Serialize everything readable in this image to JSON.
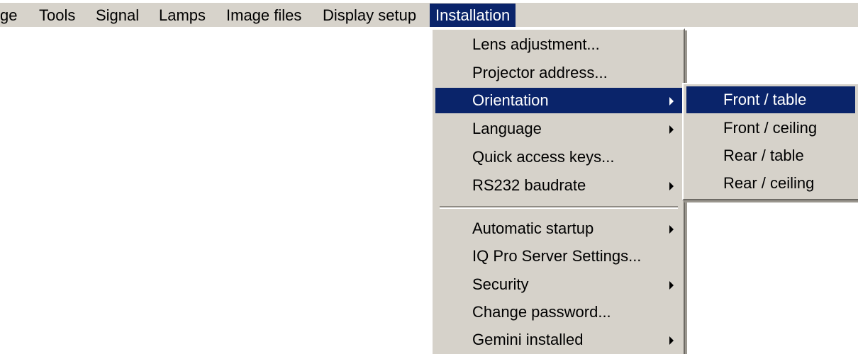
{
  "menubar": {
    "items": [
      {
        "label": "ge"
      },
      {
        "label": "Tools"
      },
      {
        "label": "Signal"
      },
      {
        "label": "Lamps"
      },
      {
        "label": "Image files"
      },
      {
        "label": "Display setup"
      },
      {
        "label": "Installation"
      }
    ]
  },
  "installation_menu": {
    "items": [
      {
        "label": "Lens adjustment..."
      },
      {
        "label": "Projector address..."
      },
      {
        "label": "Orientation"
      },
      {
        "label": "Language"
      },
      {
        "label": "Quick access keys..."
      },
      {
        "label": "RS232 baudrate"
      },
      {
        "label": "Automatic startup"
      },
      {
        "label": "IQ Pro Server Settings..."
      },
      {
        "label": "Security"
      },
      {
        "label": "Change password..."
      },
      {
        "label": "Gemini installed"
      }
    ]
  },
  "orientation_submenu": {
    "items": [
      {
        "label": "Front / table"
      },
      {
        "label": "Front / ceiling"
      },
      {
        "label": "Rear / table"
      },
      {
        "label": "Rear / ceiling"
      }
    ]
  },
  "colors": {
    "menu_background": "#d6d2ca",
    "highlight": "#0a246a",
    "highlight_text": "#ffffff"
  },
  "icons": {
    "submenu_arrow": "triangle-right"
  }
}
